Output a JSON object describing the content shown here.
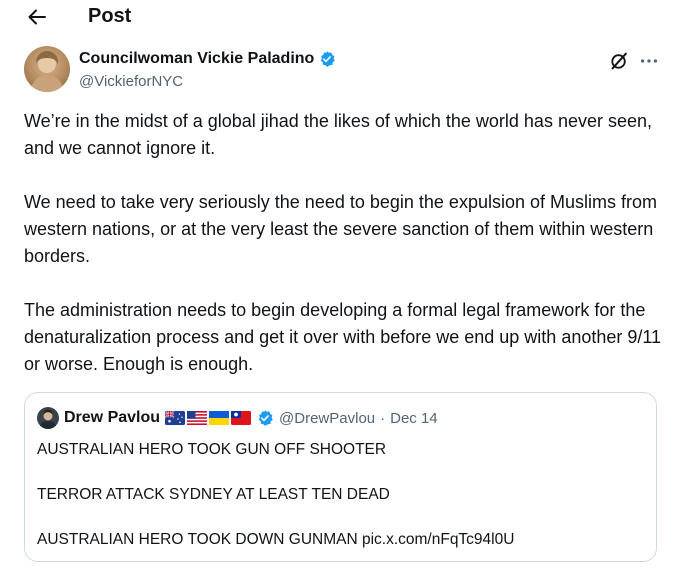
{
  "header": {
    "back_icon": "arrow-left-icon",
    "title": "Post"
  },
  "author": {
    "name": "Councilwoman Vickie Paladino",
    "handle": "@VickieforNYC",
    "verified": true,
    "verified_color": "#1d9bf0"
  },
  "actions": {
    "grok_icon": "grok-icon",
    "more_icon": "more-horizontal-icon"
  },
  "post": {
    "paragraphs": [
      "We’re in the midst of a global jihad the likes of which the world has never seen, and we cannot ignore it.",
      "We need to take very seriously the need to begin the expulsion of Muslims from western nations, or at the very least the severe sanction of them within western borders.",
      "The administration needs to begin developing a formal legal framework for the denaturalization process and get it over with before we end up with another 9/11 or worse. Enough is enough."
    ]
  },
  "quote": {
    "name": "Drew Pavlou",
    "flags": [
      "australia-flag",
      "usa-flag",
      "ukraine-flag",
      "taiwan-flag"
    ],
    "verified": true,
    "handle": "@DrewPavlou",
    "separator": "·",
    "date": "Dec 14",
    "lines": [
      "AUSTRALIAN HERO TOOK GUN OFF SHOOTER",
      "TERROR ATTACK SYDNEY AT LEAST TEN DEAD",
      "AUSTRALIAN HERO TOOK DOWN GUNMAN pic.x.com/nFqTc94l0U"
    ]
  },
  "colors": {
    "text": "#0f1419",
    "secondary": "#536471",
    "border": "#cfd9de",
    "accent": "#1d9bf0"
  }
}
